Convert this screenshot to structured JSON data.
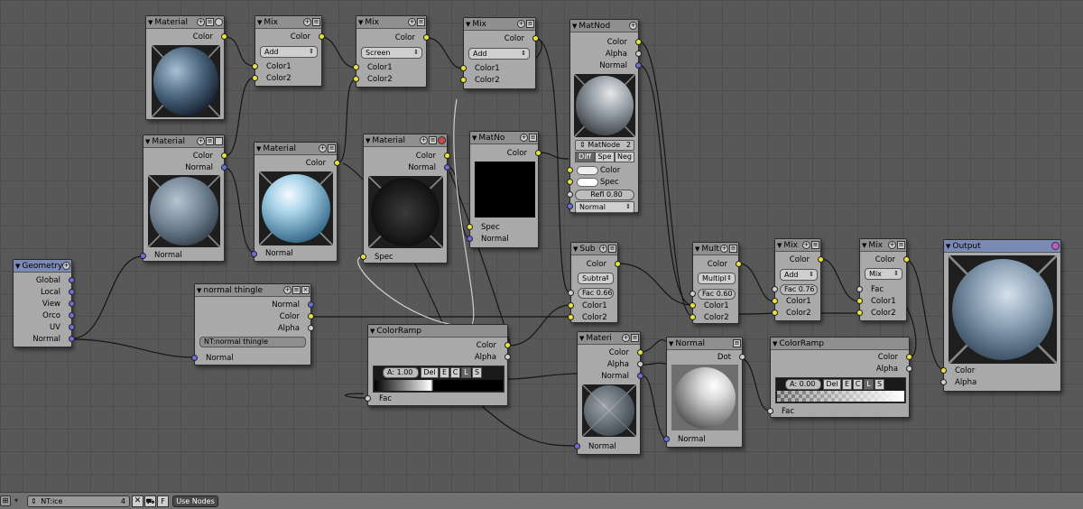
{
  "nodes": {
    "mat1": {
      "title": "Material",
      "out": [
        "Color"
      ]
    },
    "mix1": {
      "title": "Mix",
      "out": [
        "Color"
      ],
      "mode": "Add",
      "in": [
        "Color1",
        "Color2"
      ]
    },
    "mix2": {
      "title": "Mix",
      "out": [
        "Color"
      ],
      "mode": "Screen",
      "in": [
        "Color1",
        "Color2"
      ]
    },
    "mix3": {
      "title": "Mix",
      "out": [
        "Color"
      ],
      "mode": "Add",
      "in": [
        "Color1",
        "Color2"
      ]
    },
    "matnod": {
      "title": "MatNod",
      "out": [
        "Color",
        "Alpha",
        "Normal"
      ],
      "matname": "MatNode",
      "users": "2",
      "tabs": [
        "Diff",
        "Spe",
        "Neg"
      ],
      "inputs": [
        "Color",
        "Spec"
      ],
      "refl": "Refl 0.80",
      "in_normal": "Normal"
    },
    "mat2": {
      "title": "Material",
      "out": [
        "Color",
        "Normal"
      ],
      "in": [
        "Normal"
      ]
    },
    "mat3": {
      "title": "Material",
      "out": [
        "Color"
      ],
      "in": [
        "Normal"
      ]
    },
    "mat4": {
      "title": "Material",
      "out": [
        "Color",
        "Normal"
      ],
      "in": [
        "Spec"
      ]
    },
    "matno": {
      "title": "MatNo",
      "out": [
        "Color"
      ],
      "in": [
        "Spec",
        "Normal"
      ]
    },
    "geometry": {
      "title": "Geometry",
      "out": [
        "Global",
        "Local",
        "View",
        "Orco",
        "UV",
        "Normal"
      ]
    },
    "normthingle": {
      "title": "normal thingle",
      "out": [
        "Normal",
        "Color",
        "Alpha"
      ],
      "name": "NT:normal thingle",
      "in": [
        "Normal"
      ]
    },
    "ramp1": {
      "title": "ColorRamp",
      "out": [
        "Color",
        "Alpha"
      ],
      "alpha": "A: 1.00",
      "btns": [
        "Del",
        "E",
        "C",
        "L",
        "S"
      ],
      "in": [
        "Fac"
      ]
    },
    "sub": {
      "title": "Sub",
      "out": [
        "Color"
      ],
      "mode": "Subtra",
      "fac": "Fac 0.66",
      "in": [
        "Color1",
        "Color2"
      ]
    },
    "materi": {
      "title": "Materi",
      "out": [
        "Color",
        "Alpha",
        "Normal"
      ],
      "in": [
        "Normal"
      ]
    },
    "normal": {
      "title": "Normal",
      "out": [
        "Dot"
      ],
      "in": [
        "Normal"
      ]
    },
    "mult": {
      "title": "Mult",
      "out": [
        "Color"
      ],
      "mode": "Multipl",
      "fac": "Fac 0.60",
      "in": [
        "Color1",
        "Color2"
      ]
    },
    "mix4": {
      "title": "Mix",
      "out": [
        "Color"
      ],
      "mode": "Add",
      "fac": "Fac 0.76",
      "in": [
        "Color1",
        "Color2"
      ]
    },
    "mix5": {
      "title": "Mix",
      "out": [
        "Color"
      ],
      "mode": "Mix",
      "in": [
        "Fac",
        "Color1",
        "Color2"
      ]
    },
    "ramp2": {
      "title": "ColorRamp",
      "out": [
        "Color",
        "Alpha"
      ],
      "alpha": "A: 0.00",
      "btns": [
        "Del",
        "E",
        "C",
        "L",
        "S"
      ],
      "in": [
        "Fac"
      ]
    },
    "output": {
      "title": "Output",
      "in": [
        "Color",
        "Alpha"
      ]
    }
  },
  "bar": {
    "tree": "NT:ice",
    "users": "4",
    "f": "F",
    "use_nodes": "Use Nodes"
  },
  "colors": {
    "background": "#585858",
    "node": "#a9a9a9",
    "socket_color": "#e8e23a",
    "socket_vector": "#6d6de0",
    "socket_value": "#cfcfcf"
  }
}
